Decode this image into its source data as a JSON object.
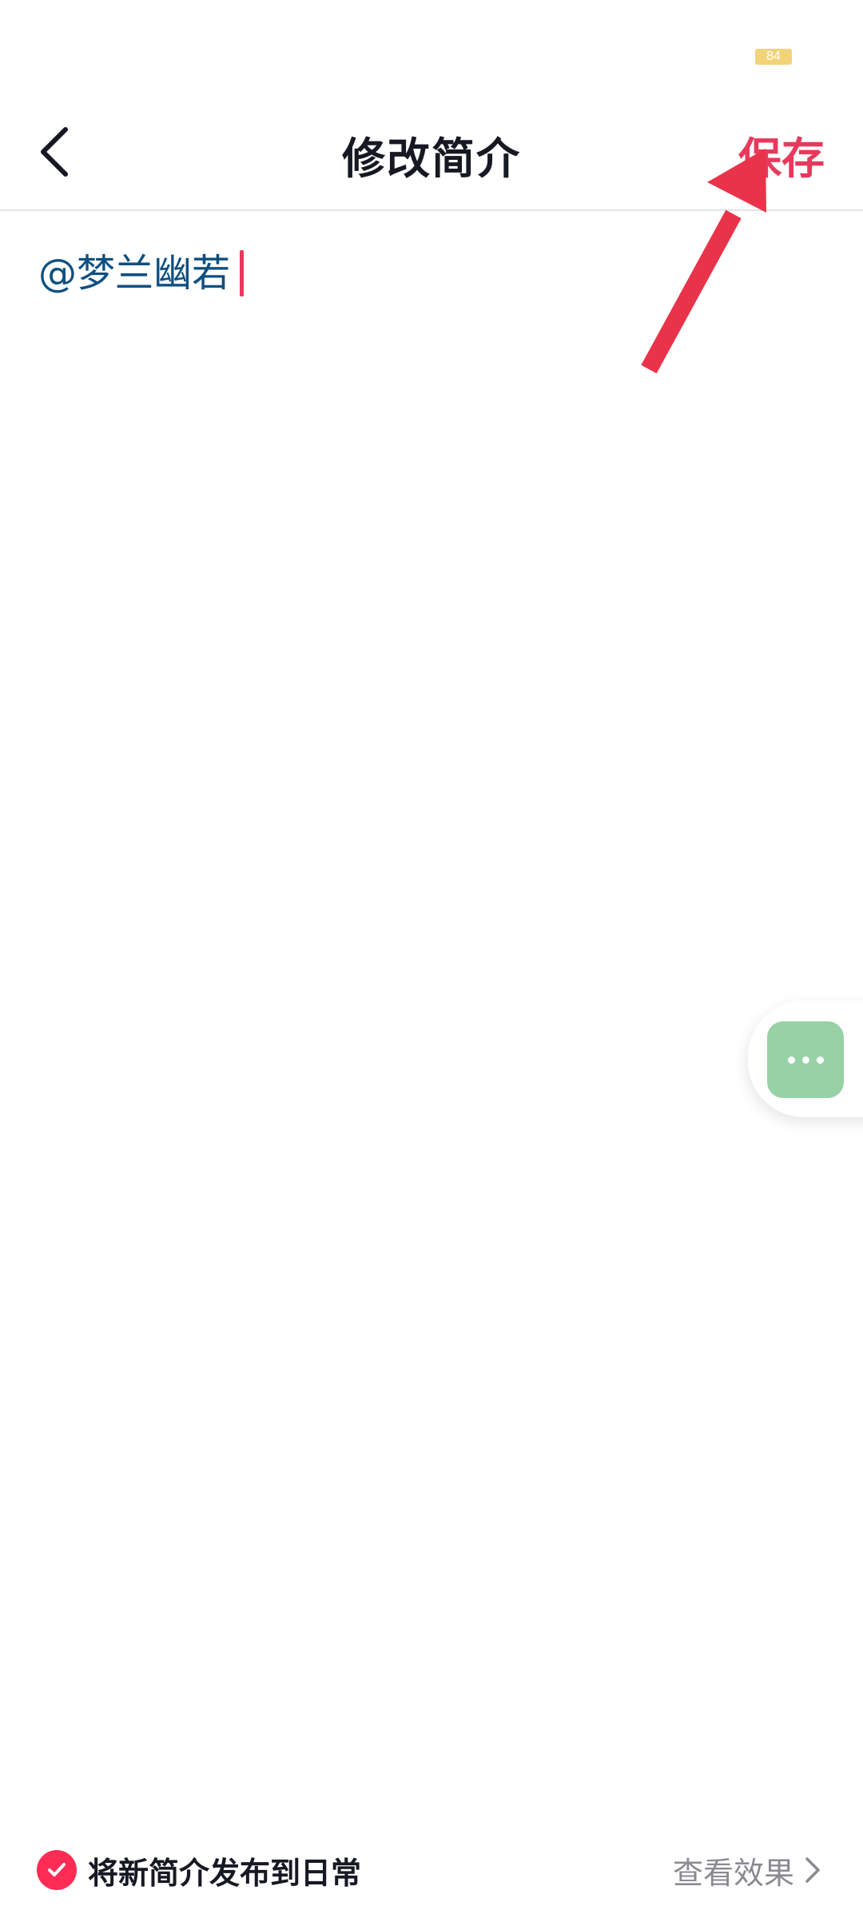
{
  "status_bar": {
    "battery_level": "84",
    "battery_color": "#f3d37a"
  },
  "header": {
    "back_icon": "chevron-left-icon",
    "title": "修改简介",
    "save_label": "保存"
  },
  "editor": {
    "value": "@梦兰幽若",
    "mention_color": "#0f4f80",
    "cursor_color": "#e8395d"
  },
  "floating_menu": {
    "icon": "more-dots-icon",
    "color": "#97d2a6"
  },
  "annotation": {
    "type": "arrow",
    "points_to": "save-button",
    "color": "#e8334a"
  },
  "footer": {
    "publish_toggle_checked": true,
    "publish_label": "将新简介发布到日常",
    "view_effect_label": "查看效果",
    "accent_color": "#fe2c55"
  }
}
